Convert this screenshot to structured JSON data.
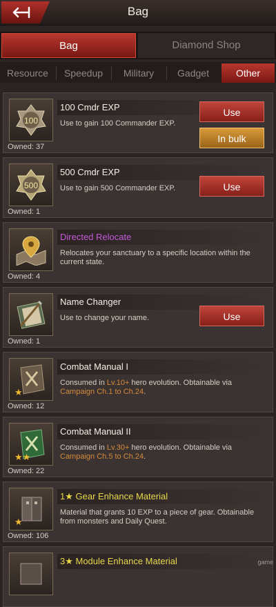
{
  "header": {
    "title": "Bag"
  },
  "main_tabs": [
    {
      "label": "Bag"
    },
    {
      "label": "Diamond Shop"
    }
  ],
  "sub_tabs": [
    {
      "label": "Resource"
    },
    {
      "label": "Speedup"
    },
    {
      "label": "Military"
    },
    {
      "label": "Gadget"
    },
    {
      "label": "Other"
    }
  ],
  "items": [
    {
      "name": "100 Cmdr EXP",
      "desc": "Use to gain 100 Commander EXP.",
      "owned": "Owned: 37",
      "use": "Use",
      "bulk": "In bulk",
      "icon_label": "100"
    },
    {
      "name": "500 Cmdr EXP",
      "desc": "Use to gain 500 Commander EXP.",
      "owned": "Owned: 1",
      "use": "Use",
      "icon_label": "500"
    },
    {
      "name": "Directed Relocate",
      "desc": "Relocates your sanctuary to a specific location within the current state.",
      "owned": "Owned: 4"
    },
    {
      "name": "Name Changer",
      "desc": "Use to change your name.",
      "owned": "Owned: 1",
      "use": "Use"
    },
    {
      "name": "Combat Manual I",
      "desc_a": "Consumed in ",
      "desc_b": "Lv.10+",
      "desc_c": " hero evolution. Obtainable via ",
      "desc_d": "Campaign Ch.1 to Ch.24",
      "desc_e": ".",
      "owned": "Owned: 12",
      "stars": "★"
    },
    {
      "name": "Combat Manual II",
      "desc_a": "Consumed in ",
      "desc_b": "Lv.30+",
      "desc_c": " hero evolution. Obtainable via ",
      "desc_d": "Campaign Ch.5 to Ch.24",
      "desc_e": ".",
      "owned": "Owned: 22",
      "stars": "★★"
    },
    {
      "name": "1★ Gear Enhance Material",
      "desc": "Material that grants 10 EXP to a piece of gear. Obtainable from monsters and Daily Quest.",
      "owned": "Owned: 106",
      "stars": "★"
    },
    {
      "name": "3★ Module Enhance Material"
    }
  ],
  "watermark": "game",
  "colors": {
    "accent_red": "#b8372e",
    "gold": "#d89a3a",
    "purple_name": "#c45ad8",
    "yellow_name": "#e8d84a",
    "highlight": "#d58a3a"
  }
}
